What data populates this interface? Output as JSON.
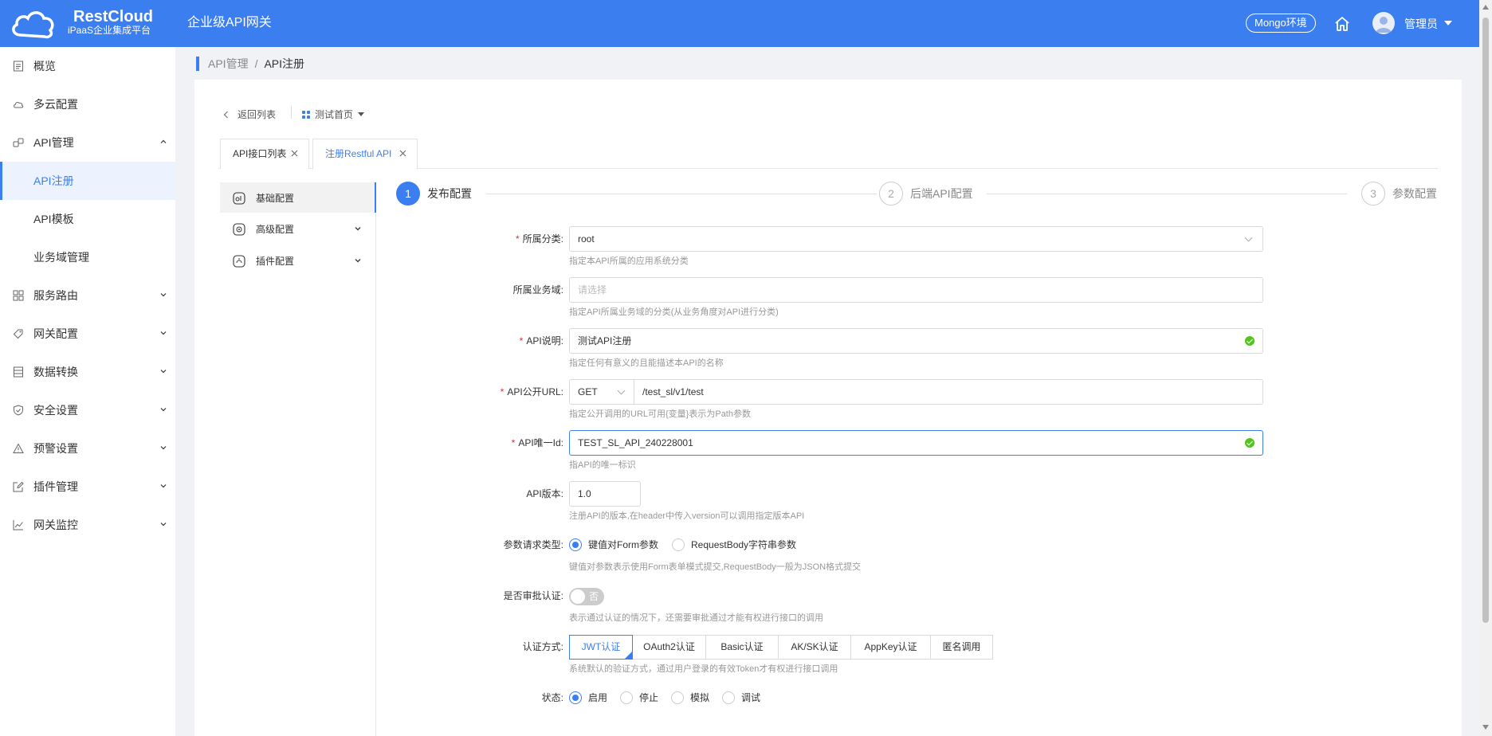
{
  "header": {
    "brand_title": "RestCloud",
    "brand_subtitle": "iPaaS企业集成平台",
    "app_name": "企业级API网关",
    "env_badge": "Mongo环境",
    "user_name": "管理员",
    "accent_color": "#3b7ef0"
  },
  "sidebar": {
    "items": [
      {
        "label": "概览",
        "icon": "document-icon"
      },
      {
        "label": "多云配置",
        "icon": "cloud-icon"
      },
      {
        "label": "API管理",
        "icon": "link-icon",
        "expanded": true
      },
      {
        "label": "API注册",
        "active": true
      },
      {
        "label": "API模板"
      },
      {
        "label": "业务域管理"
      },
      {
        "label": "服务路由",
        "icon": "grid-icon"
      },
      {
        "label": "网关配置",
        "icon": "tag-icon"
      },
      {
        "label": "数据转换",
        "icon": "table-icon"
      },
      {
        "label": "安全设置",
        "icon": "shield-icon"
      },
      {
        "label": "预警设置",
        "icon": "warning-icon"
      },
      {
        "label": "插件管理",
        "icon": "edit-icon"
      },
      {
        "label": "网关监控",
        "icon": "chart-line-icon"
      }
    ]
  },
  "breadcrumb": {
    "parent": "API管理",
    "sep": "/",
    "current": "API注册"
  },
  "toolbar": {
    "back_label": "返回列表",
    "home_label": "测试首页"
  },
  "tabs": [
    {
      "label": "API接口列表"
    },
    {
      "label": "注册Restful API",
      "active": true
    }
  ],
  "config_menu": [
    {
      "label": "基础配置",
      "active": true
    },
    {
      "label": "高级配置"
    },
    {
      "label": "插件配置"
    }
  ],
  "steps": [
    {
      "num": "1",
      "label": "发布配置",
      "active": true
    },
    {
      "num": "2",
      "label": "后端API配置"
    },
    {
      "num": "3",
      "label": "参数配置"
    }
  ],
  "form": {
    "category": {
      "label": "所属分类:",
      "value": "root",
      "hint": "指定本API所属的应用系统分类"
    },
    "domain": {
      "label": "所属业务域:",
      "placeholder": "请选择",
      "hint": "指定API所属业务域的分类(从业务角度对API进行分类)"
    },
    "desc": {
      "label": "API说明:",
      "value": "测试API注册",
      "hint": "指定任何有意义的且能描述本API的名称"
    },
    "url": {
      "label": "API公开URL:",
      "method": "GET",
      "value": "/test_sl/v1/test",
      "hint": "指定公开调用的URL可用{变量}表示为Path参数"
    },
    "uid": {
      "label": "API唯一Id:",
      "value": "TEST_SL_API_240228001",
      "hint": "指API的唯一标识"
    },
    "version": {
      "label": "API版本:",
      "value": "1.0",
      "hint": "注册API的版本,在header中传入version可以调用指定版本API"
    },
    "param_type": {
      "label": "参数请求类型:",
      "options": [
        "键值对Form参数",
        "RequestBody字符串参数"
      ],
      "selected": "键值对Form参数",
      "hint": "键值对参数表示使用Form表单模式提交,RequestBody一般为JSON格式提交"
    },
    "approval": {
      "label": "是否审批认证:",
      "toggle_text": "否",
      "enabled": false,
      "hint": "表示通过认证的情况下，还需要审批通过才能有权进行接口的调用"
    },
    "auth": {
      "label": "认证方式:",
      "options": [
        "JWT认证",
        "OAuth2认证",
        "Basic认证",
        "AK/SK认证",
        "AppKey认证",
        "匿名调用"
      ],
      "selected": "JWT认证",
      "hint": "系统默认的验证方式，通过用户登录的有效Token才有权进行接口调用"
    },
    "status": {
      "label": "状态:",
      "options": [
        "启用",
        "停止",
        "模拟",
        "调试"
      ],
      "selected": "启用"
    }
  }
}
